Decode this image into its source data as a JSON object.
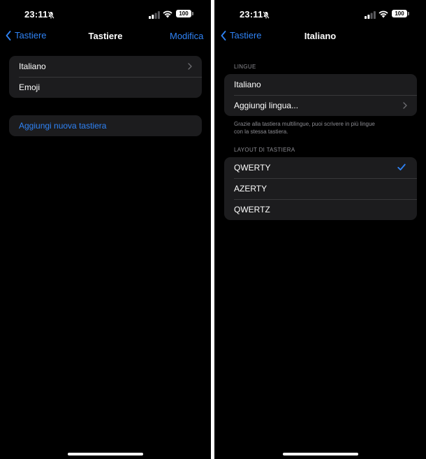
{
  "left": {
    "status": {
      "time": "23:11",
      "battery": "100"
    },
    "nav": {
      "back_label": "Tastiere",
      "title": "Tastiere",
      "action_label": "Modifica"
    },
    "keyboards": [
      {
        "label": "Italiano",
        "chevron": true
      },
      {
        "label": "Emoji",
        "chevron": false
      }
    ],
    "add_keyboard_label": "Aggiungi nuova tastiera"
  },
  "right": {
    "status": {
      "time": "23:11",
      "battery": "100"
    },
    "nav": {
      "back_label": "Tastiere",
      "title": "Italiano"
    },
    "languages_header": "LINGUE",
    "languages": [
      {
        "label": "Italiano"
      },
      {
        "label": "Aggiungi lingua...",
        "chevron": true
      }
    ],
    "languages_footnote_line1": "Grazie alla tastiera multilingue, puoi scrivere in più lingue",
    "languages_footnote_line2": "con la stessa tastiera.",
    "layout_header": "LAYOUT DI TASTIERA",
    "layouts": [
      {
        "label": "QWERTY",
        "selected": true
      },
      {
        "label": "AZERTY",
        "selected": false
      },
      {
        "label": "QWERTZ",
        "selected": false
      }
    ]
  },
  "colors": {
    "accent": "#2f83f6",
    "background": "#000000",
    "cell": "#1c1c1e",
    "secondary_text": "#8d8d93"
  },
  "icons": [
    "bell-slash-icon",
    "cellular-signal-icon",
    "wifi-icon",
    "battery-icon",
    "chevron-left-icon",
    "chevron-right-icon",
    "checkmark-icon"
  ]
}
